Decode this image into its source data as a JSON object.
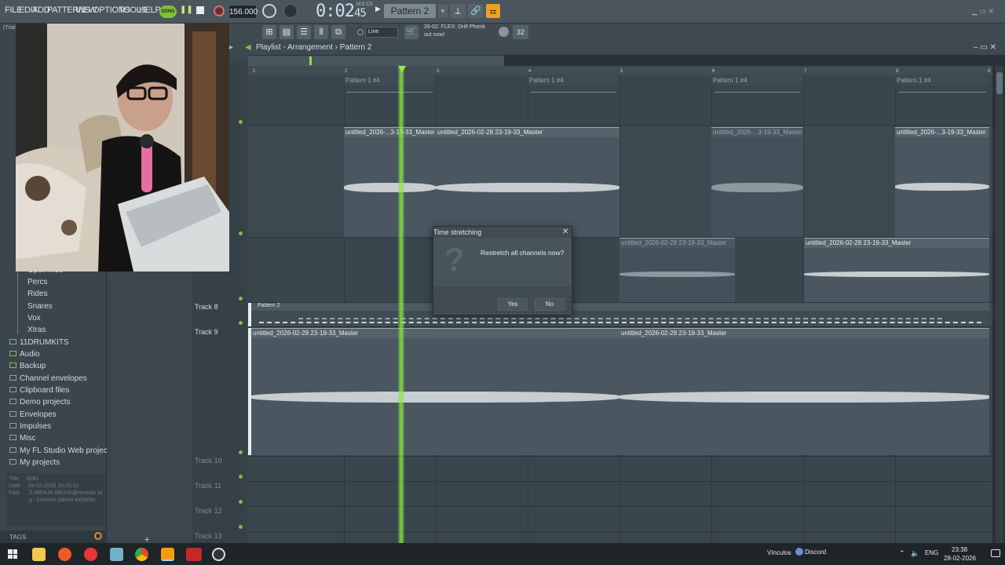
{
  "menu": [
    "FILE",
    "EDIT",
    "ADD",
    "PATTERNS",
    "VIEW",
    "OPTIONS",
    "TOOLS",
    "HELP"
  ],
  "transport": {
    "song_label": "SONG",
    "tempo": "156.000",
    "time_main": "0:02",
    "time_sub": "45",
    "time_units": "M:S:CS",
    "pattern": "Pattern 2"
  },
  "hint": {
    "line1": "26-02: FLEX: Drift Phonk",
    "line2": "out now!"
  },
  "toolbar2": {
    "snap": "Line",
    "counter": "32"
  },
  "playlist": {
    "title": "Playlist - Arrangement",
    "pattern": "Pattern 2",
    "bars": [
      "1",
      "2",
      "3",
      "4",
      "5",
      "6",
      "7",
      "8",
      "9"
    ]
  },
  "tracks": {
    "t8": "Track 8",
    "t9": "Track 9",
    "t10": "Track 10",
    "t11": "Track 11",
    "t12": "Track 12",
    "t13": "Track 13"
  },
  "clips": {
    "pattern_clip": "Pattern 1 #4",
    "pattern2": "Pattern 2",
    "audio_full": "untitled_2026-02-28 23-19-33_Master",
    "audio_short": "untitled_2026-...3-19-33_Master",
    "audio_short2": "untitled_2026-...3-19-33_Master"
  },
  "browser": {
    "top_label": "(Trial",
    "subs": [
      "Open files",
      "Percs",
      "Rides",
      "Snares",
      "Vox",
      "Xtras"
    ],
    "items": [
      "11DRUMKITS",
      "Audio",
      "Backup",
      "Channel envelopes",
      "Clipboard files",
      "Demo projects",
      "Envelopes",
      "Impulses",
      "Misc",
      "My FL Studio Web projects",
      "My projects"
    ],
    "info": {
      "title_k": "Title",
      "title_v": "808s",
      "date_k": "Date",
      "date_v": "28-02-2026 20:15:52",
      "path_k": "Path",
      "path_v": "Z:\\BENJA WEAS\\@nimeda wig - kmones (demo kit)\\808s"
    },
    "tags": "TAGS"
  },
  "dialog": {
    "title": "Time stretching",
    "message": "Restretch all channels now?",
    "yes": "Yes",
    "no": "No",
    "icon": "?"
  },
  "taskbar": {
    "vinculos": "Vínculos",
    "discord": "Discord",
    "lang": "ENG",
    "time": "23:38",
    "date": "28-02-2026"
  },
  "colors": {
    "playhead": "#8fe046",
    "song_button": "#7fbf3a",
    "led": "#7bc043"
  }
}
